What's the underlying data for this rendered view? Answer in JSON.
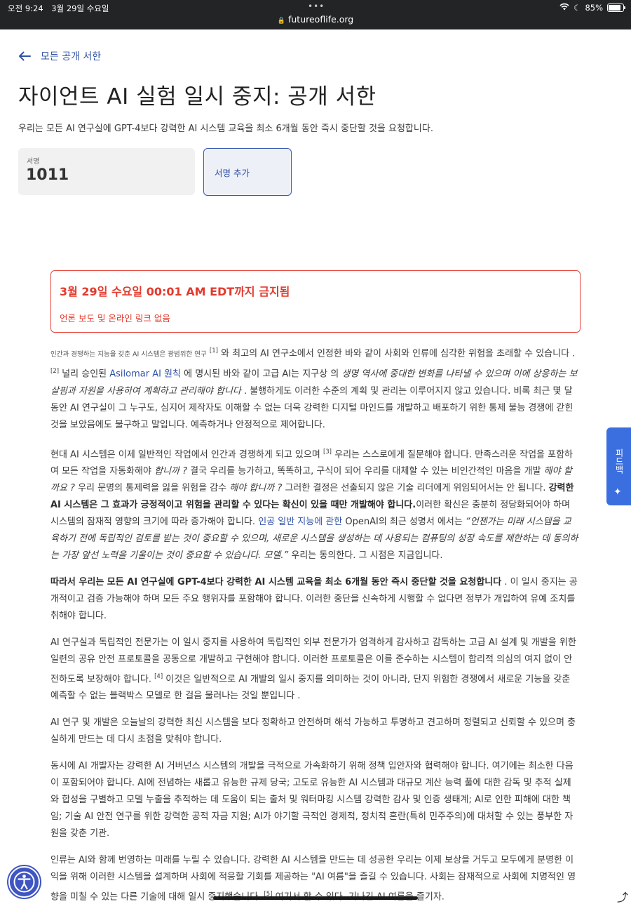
{
  "status_bar": {
    "time": "오전 9:24",
    "date": "3월 29일 수요일",
    "url": "futureoflife.org",
    "battery": "85%",
    "battery_level": 0.85,
    "dots": "•••"
  },
  "nav": {
    "back_label": "모든 공개 서한"
  },
  "page": {
    "title": "자이언트 AI 실험 일시 중지: 공개 서한",
    "lead": "우리는 모든 AI 연구실에 GPT-4보다 강력한 AI 시스템 교육을 최소 6개월 동안 즉시 중단할 것을 요청합니다."
  },
  "signatures": {
    "label": "서명",
    "count": "1011",
    "add_button": "서명 추가"
  },
  "embargo": {
    "title": "3월 29일 수요일 00:01 AM EDT까지 금지됨",
    "subtitle": "언론 보도 및 온라인 링크 없음"
  },
  "letter": {
    "p1": {
      "s1": "인간과 경쟁하는 지능을 갖춘 AI 시스템은 광범위한 연구",
      "r1": "[1]",
      "s2": " 와 최고의 AI 연구소에서 인정한 바와 같이 사회와 인류에 심각한 위험을 초래할 수 있습니다 .",
      "r2": "[2]",
      "s3": " 널리 승인된 ",
      "link1": "Asilomar AI 원칙",
      "s4": " 에 명시된 바와 같이 고급 AI는 지구상 의 ",
      "em1": "생명 역사에 중대한 변화를 나타낼 수 있으며 이에 상응하는 보살핌과 자원을 사용하여 계획하고 관리해야 합니다",
      "s5": " . 불행하게도 이러한 수준의 계획 및 관리는 이루어지지 않고 있습니다. 비록 최근 몇 달 동안 AI 연구실이 그 누구도, 심지어 제작자도 이해할 수 없는 더욱 강력한 디지털 마인드를 개발하고 배포하기 위한 통제 불능 경쟁에 갇힌 것을 보았음에도 불구하고 말입니다. 예측하거나 안정적으로 제어합니다."
    },
    "p2": {
      "s1": "현대 AI 시스템은 이제 일반적인 작업에서 인간과 경쟁하게 되고 있으며 ",
      "r3": "[3]",
      "s2": " 우리는 스스로에게 질문해야 합니다. 만족스러운 작업을 포함하여 모든 작업을 자동화해야 ",
      "em1": "합니까 ?",
      "s3": "  결국 우리를 능가하고, 똑똑하고, 구식이 되어 우리를 대체할 수 있는 비인간적인 마음을 개발 ",
      "em2": "해야 할까요 ?",
      "s4": " 우리 문명의 통제력을 잃을 위험을 감수 ",
      "em3": "해야 합니까 ?",
      "s5": " 그러한 결정은 선출되지 않은 기술 리더에게 위임되어서는 안 됩니다. ",
      "strong1": "강력한 AI 시스템은 그 효과가 긍정적이고 위험을 관리할 수 있다는 확신이 있을 때만 개발해야 합니다.",
      "s6": "이러한 확신은 충분히 정당화되어야 하며 시스템의 잠재적 영향의 크기에 따라 증가해야 합니다. ",
      "link1": "인공 일반 지능에 관한",
      "s7": " OpenAI의 최근 성명서 에서는 ",
      "em4": "“언젠가는 미래 시스템을 교육하기 전에 독립적인 검토를 받는 것이 중요할 수 있으며, 새로운 시스템을 생성하는 데 사용되는 컴퓨팅의 성장 속도를 제한하는 데 동의하는 가장 앞선 노력을 기울이는 것이 중요할 수 있습니다. 모델.”",
      "s8": " 우리는 동의한다. 그 시점은 지금입니다."
    },
    "p3": {
      "strong1": "따라서 우리는 모든 AI 연구실에 GPT-4보다 강력한 AI 시스템 교육을 최소 6개월 동안 즉시 중단할 것을 요청합니다",
      "s1": " . 이 일시 중지는 공개적이고 검증 가능해야 하며 모든 주요 행위자를 포함해야 합니다. 이러한 중단을 신속하게 시행할 수 없다면 정부가 개입하여 유예 조치를 취해야 합니다."
    },
    "p4": {
      "s1": "AI 연구실과 독립적인 전문가는 이 일시 중지를 사용하여 독립적인 외부 전문가가 엄격하게 감사하고 감독하는 고급 AI 설계 및 개발을 위한 일련의 공유 안전 프로토콜을 공동으로 개발하고 구현해야 합니다. 이러한 프로토콜은 이를 준수하는 시스템이 합리적 의심의 여지 없이 안전하도록 보장해야 합니다. ",
      "r4": "[4]",
      "s2": " 이것은 일반적으로 AI 개발의 일시 중지를 의미하는 것이 아니라, 단지 위험한 경쟁에서 새로운 기능을 갖춘 예측할 수 없는 블랙박스 모델로 한 걸음 물러나는 것일 뿐입니다 ."
    },
    "p5": "AI 연구 및 개발은 오늘날의 강력한 최신 시스템을 보다 정확하고 안전하며 해석 가능하고 투명하고 견고하며 정렬되고 신뢰할 수 있으며 충실하게 만드는 데 다시 초점을 맞춰야 합니다.",
    "p6": "동시에 AI 개발자는 강력한 AI 거버넌스 시스템의 개발을 극적으로 가속화하기 위해 정책 입안자와 협력해야 합니다. 여기에는 최소한 다음이 포함되어야 합니다. AI에 전념하는 새롭고 유능한 규제 당국; 고도로 유능한 AI 시스템과 대규모 계산 능력 풀에 대한 감독 및 추적 실제와 합성을 구별하고 모델 누출을 추적하는 데 도움이 되는 출처 및 워터마킹 시스템 강력한 감사 및 인증 생태계; AI로 인한 피해에 대한 책임; 기술 AI 안전 연구를 위한 강력한 공적 자금 지원; AI가 야기할 극적인 경제적, 정치적 혼란(특히 민주주의)에 대처할 수 있는 풍부한 자원을 갖춘 기관.",
    "p7": {
      "s1": "인류는 AI와 함께 번영하는 미래를 누릴 수 있습니다. 강력한 AI 시스템을 만드는 데 성공한 우리는 이제 보상을 거두고 모두에게 분명한 이익을 위해 이러한 시스템을 설계하며 사회에 적응할 기회를 제공하는 \"AI 여름\"을 즐길 수 있습니다. 사회는 잠재적으로 사회에 치명적인 영향을 미칠 수 있는 다른 기술에 대해 일시 중지했습니다. ",
      "r5": "[5]",
      "s2": "   여기서 할 수 있다. 기나긴 AI 여름을 즐기자."
    }
  },
  "feedback_tab": {
    "label": "피드백",
    "icon": "sparkle-icon"
  },
  "accessibility": {
    "icon": "accessibility-icon",
    "color": "#3f55c2"
  },
  "colors": {
    "accent": "#3153a6",
    "alert": "#e23a2e",
    "feedback": "#3b6fe0"
  }
}
